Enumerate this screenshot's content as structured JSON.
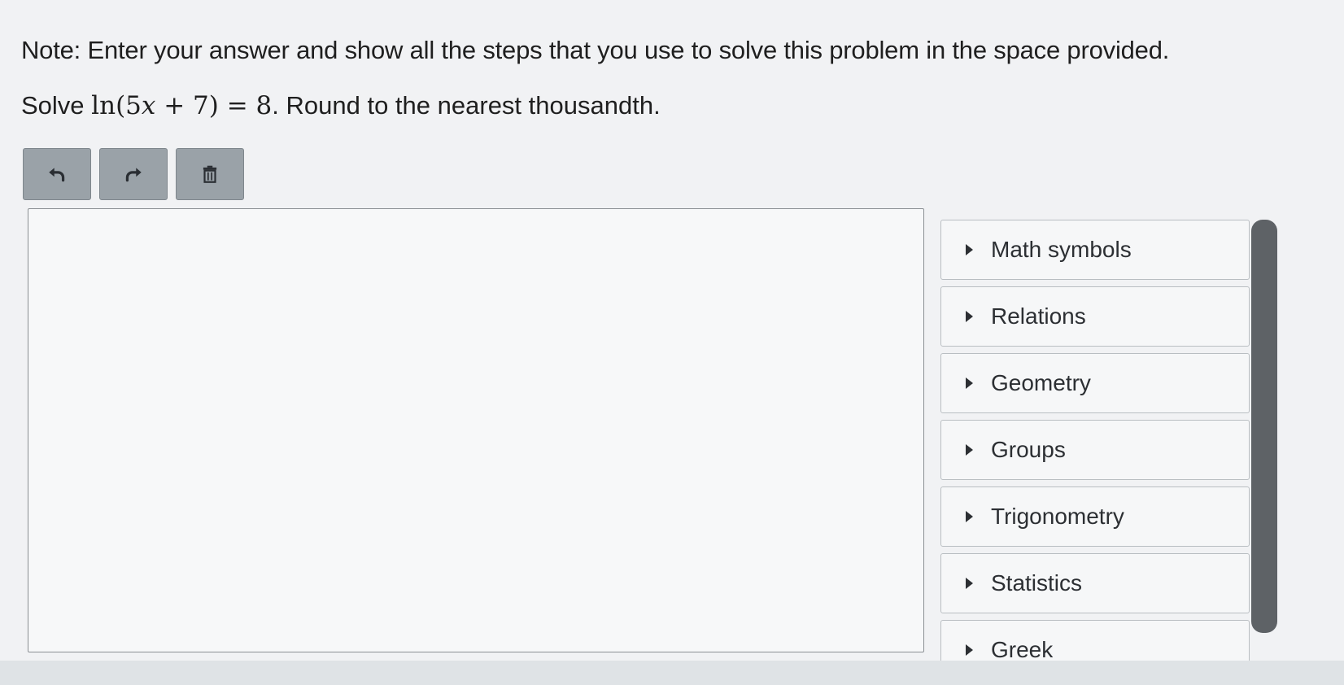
{
  "note": "Note: Enter your answer and show all the steps that you use to solve this problem in the space provided.",
  "question": {
    "prefix": "Solve ",
    "equation_fn": "ln",
    "equation_open": "(5",
    "equation_var": "x",
    "equation_rest": " + 7) = 8",
    "suffix": ". Round to the nearest thousandth."
  },
  "toolbar": {
    "undo_icon": "undo-arrow",
    "redo_icon": "redo-arrow",
    "clear_icon": "trash-can"
  },
  "palette": {
    "items": [
      {
        "label": "Math symbols"
      },
      {
        "label": "Relations"
      },
      {
        "label": "Geometry"
      },
      {
        "label": "Groups"
      },
      {
        "label": "Trigonometry"
      },
      {
        "label": "Statistics"
      },
      {
        "label": "Greek"
      }
    ]
  },
  "colors": {
    "toolbar_button": "#9aa2a8",
    "scrollbar_thumb": "#5e6266"
  }
}
